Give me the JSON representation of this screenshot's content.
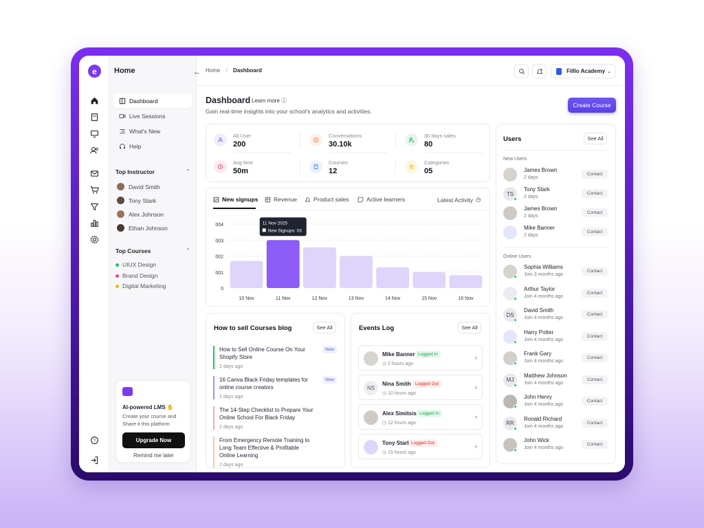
{
  "nav": {
    "title": "Home",
    "items": [
      {
        "label": "Dashboard",
        "icon": "dashboard-icon"
      },
      {
        "label": "Live Sessions",
        "icon": "video-icon"
      },
      {
        "label": "What's New",
        "icon": "list-icon"
      },
      {
        "label": "Help",
        "icon": "headphones-icon"
      }
    ],
    "top_instructor_label": "Top Instructor",
    "instructors": [
      "David Smith",
      "Tony Stark",
      "Alex Johnson",
      "Ethan Johnson"
    ],
    "top_courses_label": "Top Courses",
    "courses": [
      {
        "label": "UIUX Design",
        "color": "#22c55e"
      },
      {
        "label": "Brand Design",
        "color": "#ec4899"
      },
      {
        "label": "Digital Marketing",
        "color": "#f5b50b"
      }
    ],
    "promo": {
      "title": "AI-powered LMS ✋",
      "desc": "Create your course and Share it this platform",
      "button": "Upgrade Now",
      "later": "Remind me later"
    }
  },
  "topbar": {
    "breadcrumb_home": "Home",
    "breadcrumb_sep": "/",
    "breadcrumb_current": "Dashboard",
    "account": "Filllo Academy"
  },
  "header": {
    "title": "Dashboard",
    "learn_more": "Learn more ⓘ",
    "subtitle": "Gain real-time insights into your school's analytics and activities.",
    "create_button": "Create Course"
  },
  "stats": [
    {
      "label": "All User",
      "value": "200",
      "color": "#7c6cf0",
      "bg": "#f0eefe"
    },
    {
      "label": "Conversations",
      "value": "30.10k",
      "color": "#e8833a",
      "bg": "#fdf1e8"
    },
    {
      "label": "30 days sales",
      "value": "80",
      "color": "#16a34a",
      "bg": "#e8f7ee"
    },
    {
      "label": "Avg time",
      "value": "50m",
      "color": "#e14a7a",
      "bg": "#fdeaf1"
    },
    {
      "label": "Courses",
      "value": "12",
      "color": "#3b82f6",
      "bg": "#eaf2fe"
    },
    {
      "label": "Categories",
      "value": "05",
      "color": "#eab308",
      "bg": "#fdf7e1"
    }
  ],
  "chart_tabs": [
    "New signups",
    "Revenue",
    "Product sales",
    "Active learners"
  ],
  "latest_activity": "Latest Activity",
  "chart_data": {
    "type": "bar",
    "categories": [
      "10 Nov",
      "11 Nov",
      "12 Nov",
      "13 Nov",
      "14 Nov",
      "15 Nov",
      "16 Nov"
    ],
    "values": [
      1.7,
      3.0,
      2.55,
      2.0,
      1.3,
      1.0,
      0.8
    ],
    "y_ticks": [
      "0",
      "001",
      "002",
      "003",
      "004"
    ],
    "ylim": [
      0,
      4
    ],
    "highlight_index": 1,
    "tooltip": {
      "title": "11 Nov 2025",
      "label": "New Signups: 03"
    },
    "bar_color": "#d9cdf8",
    "highlight_color": "#8b5cf6",
    "grid": "dashed"
  },
  "blog": {
    "title": "How to sell Courses blog",
    "see_all": "See All",
    "posts": [
      {
        "title": "How to Sell Online Course On Your Shopify Store",
        "date": "2 days ago",
        "badge": "New",
        "color": "#22c55e"
      },
      {
        "title": "16 Canva Black Friday templates for online course creators",
        "date": "2 days ago",
        "badge": "New",
        "color": "#a78bfa"
      },
      {
        "title": "The 14-Step Checklist to Prepare Your Online School For Black Friday",
        "date": "2 days ago",
        "badge": "",
        "color": "#f9a8a8"
      },
      {
        "title": "From Emergency Remote Training to Long Team Effective & Profitable Online Learning",
        "date": "2 days ago",
        "badge": "",
        "color": "#fbc99a"
      }
    ]
  },
  "events": {
    "title": "Events Log",
    "see_all": "See All",
    "items": [
      {
        "name": "Mike Banner",
        "status": "Logged In",
        "time": "2 hours ago",
        "initials": ""
      },
      {
        "name": "Nina Smith",
        "status": "Logged Out",
        "time": "10 hours ago",
        "initials": "NS"
      },
      {
        "name": "Alex Simitsis",
        "status": "Logged In",
        "time": "12 hours ago",
        "initials": ""
      },
      {
        "name": "Tony Stark",
        "status": "Logged Out",
        "time": "15 hours ago",
        "initials": ""
      }
    ]
  },
  "users": {
    "title": "Users",
    "see_all": "See All",
    "new_label": "New Users",
    "new_users": [
      {
        "name": "James Brown",
        "sub": "2 days",
        "initials": ""
      },
      {
        "name": "Tony Stark",
        "sub": "2 days",
        "initials": "TS"
      },
      {
        "name": "James Brown",
        "sub": "2 days",
        "initials": ""
      },
      {
        "name": "Mike Banner",
        "sub": "2 days",
        "initials": ""
      }
    ],
    "online_label": "Online Users",
    "online_users": [
      {
        "name": "Sophia Williams",
        "sub": "Join 3 months ago",
        "initials": ""
      },
      {
        "name": "Arthur Taylor",
        "sub": "Join 4 months ago",
        "initials": ""
      },
      {
        "name": "David Smith",
        "sub": "Join 4 months ago",
        "initials": "DS"
      },
      {
        "name": "Harry Potter",
        "sub": "Join 4 months ago",
        "initials": ""
      },
      {
        "name": "Frank Gary",
        "sub": "Join 4 months ago",
        "initials": ""
      },
      {
        "name": "Matthew Johnson",
        "sub": "Join 4 months ago",
        "initials": "MJ"
      },
      {
        "name": "John Henry",
        "sub": "Join 4 months ago",
        "initials": ""
      },
      {
        "name": "Ronald Richard",
        "sub": "Join 4 months ago",
        "initials": "RR"
      },
      {
        "name": "John Wick",
        "sub": "Join 4 months ago",
        "initials": ""
      }
    ],
    "contact_label": "Contact"
  }
}
